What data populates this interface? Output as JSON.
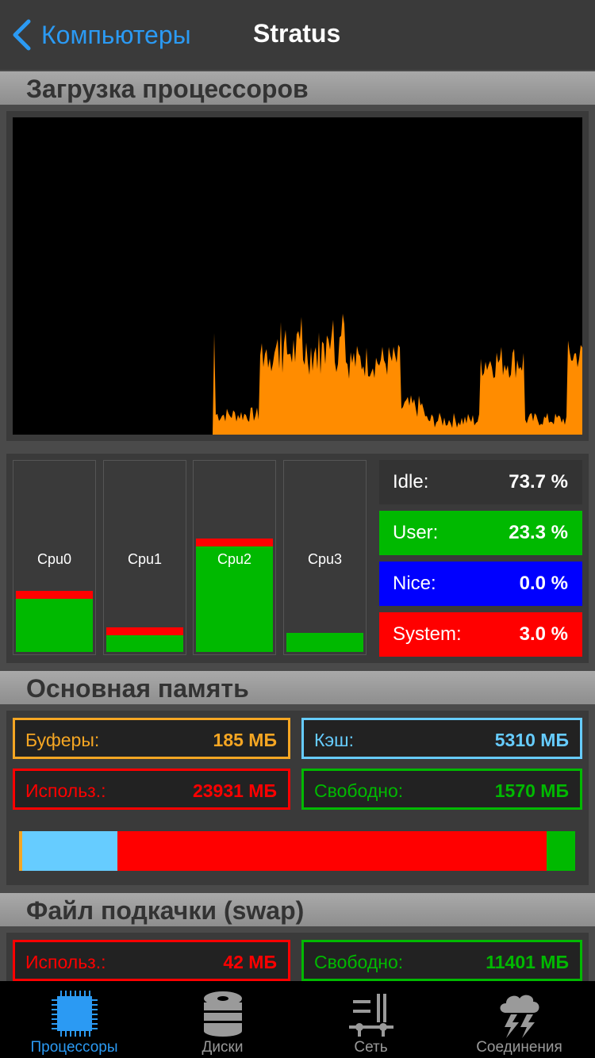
{
  "nav": {
    "back_label": "Компьютеры",
    "title": "Stratus"
  },
  "sections": {
    "cpu": "Загрузка процессоров",
    "memory": "Основная память",
    "swap": "Файл подкачки (swap)"
  },
  "cpus": [
    {
      "label": "Cpu0",
      "used": 0.28,
      "system": 0.04
    },
    {
      "label": "Cpu1",
      "used": 0.09,
      "system": 0.02
    },
    {
      "label": "Cpu2",
      "used": 0.56,
      "system": 0.04
    },
    {
      "label": "Cpu3",
      "used": 0.1,
      "system": 0.0
    }
  ],
  "stats": [
    {
      "label": "Idle:",
      "value": "73.7 %",
      "color": "#333333"
    },
    {
      "label": "User:",
      "value": "23.3 %",
      "color": "#00b900"
    },
    {
      "label": "Nice:",
      "value": "0.0 %",
      "color": "#0000ff"
    },
    {
      "label": "System:",
      "value": "3.0 %",
      "color": "#ff0000"
    }
  ],
  "memory": {
    "buffers": {
      "label": "Буферы:",
      "value": "185 МБ",
      "color": "#f5a623"
    },
    "cache": {
      "label": "Кэш:",
      "value": "5310 МБ",
      "color": "#66ccff"
    },
    "used": {
      "label": "Использ.:",
      "value": "23931 МБ",
      "color": "#ff0000"
    },
    "free": {
      "label": "Свободно:",
      "value": "1570 МБ",
      "color": "#00b900"
    },
    "bar_mb": {
      "buffers": 185,
      "cache": 5310,
      "used": 23931,
      "free": 1570
    }
  },
  "swap": {
    "used": {
      "label": "Использ.:",
      "value": "42 МБ",
      "color": "#ff0000"
    },
    "free": {
      "label": "Свободно:",
      "value": "11401 МБ",
      "color": "#00b900"
    }
  },
  "graph_color": "#ff8c00",
  "tabs": [
    {
      "label": "Процессоры",
      "icon": "cpu-icon",
      "active": true
    },
    {
      "label": "Диски",
      "icon": "disk-icon",
      "active": false
    },
    {
      "label": "Сеть",
      "icon": "network-icon",
      "active": false
    },
    {
      "label": "Соединения",
      "icon": "connections-icon",
      "active": false
    }
  ],
  "accent": "#2b9af3"
}
